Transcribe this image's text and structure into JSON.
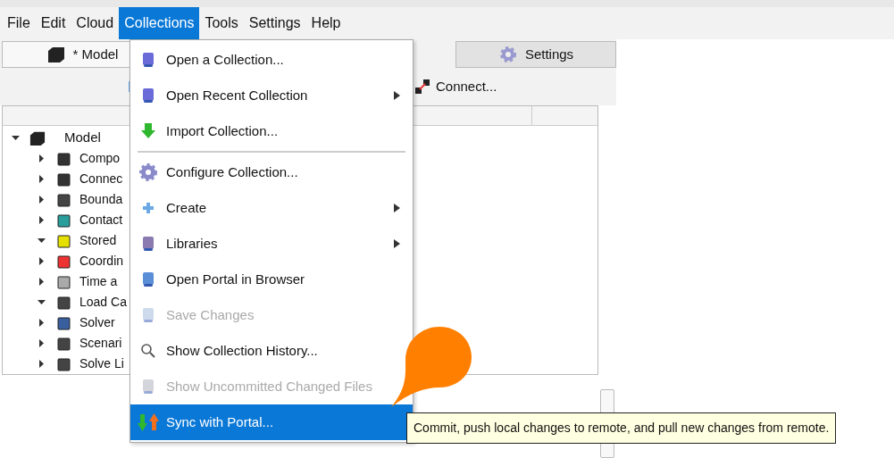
{
  "menubar": [
    {
      "label": "File",
      "selected": false
    },
    {
      "label": "Edit",
      "selected": false
    },
    {
      "label": "Cloud",
      "selected": false
    },
    {
      "label": "Collections",
      "selected": true
    },
    {
      "label": "Tools",
      "selected": false
    },
    {
      "label": "Settings",
      "selected": false
    },
    {
      "label": "Help",
      "selected": false
    }
  ],
  "tabs": [
    {
      "label": "* Model",
      "selected": true
    },
    {
      "label": "Settings",
      "selected": false
    }
  ],
  "toolbar": {
    "connect_label": "Connect..."
  },
  "tree": [
    {
      "label": "Model",
      "expanded": true,
      "children": [
        {
          "label": "Compo",
          "expanded": false
        },
        {
          "label": "Connec",
          "expanded": false
        },
        {
          "label": "Bounda",
          "expanded": false
        },
        {
          "label": "Contact",
          "expanded": false
        },
        {
          "label": "Stored",
          "expanded": true
        },
        {
          "label": "Coordin",
          "expanded": false
        },
        {
          "label": "Time a",
          "expanded": false
        },
        {
          "label": "Load Ca",
          "expanded": true
        },
        {
          "label": "Solver",
          "expanded": false
        },
        {
          "label": "Scenari",
          "expanded": false
        },
        {
          "label": "Solve Li",
          "expanded": false
        }
      ]
    }
  ],
  "menu": [
    {
      "kind": "item",
      "label": "Open a Collection...",
      "disabled": false,
      "submenu": false,
      "selected": false
    },
    {
      "kind": "item",
      "label": "Open Recent Collection",
      "disabled": false,
      "submenu": true,
      "selected": false
    },
    {
      "kind": "item",
      "label": "Import Collection...",
      "disabled": false,
      "submenu": false,
      "selected": false
    },
    {
      "kind": "separator"
    },
    {
      "kind": "item",
      "label": "Configure Collection...",
      "disabled": false,
      "submenu": false,
      "selected": false
    },
    {
      "kind": "item",
      "label": "Create",
      "disabled": false,
      "submenu": true,
      "selected": false
    },
    {
      "kind": "item",
      "label": "Libraries",
      "disabled": false,
      "submenu": true,
      "selected": false
    },
    {
      "kind": "item",
      "label": "Open Portal in Browser",
      "disabled": false,
      "submenu": false,
      "selected": false
    },
    {
      "kind": "item",
      "label": "Save Changes",
      "disabled": true,
      "submenu": false,
      "selected": false
    },
    {
      "kind": "item",
      "label": "Show Collection History...",
      "disabled": false,
      "submenu": false,
      "selected": false
    },
    {
      "kind": "item",
      "label": "Show Uncommitted Changed Files",
      "disabled": true,
      "submenu": false,
      "selected": false
    },
    {
      "kind": "item",
      "label": "Sync with Portal...",
      "disabled": false,
      "submenu": false,
      "selected": true
    }
  ],
  "tooltip": "Commit, push local changes to remote, and pull new changes from remote."
}
